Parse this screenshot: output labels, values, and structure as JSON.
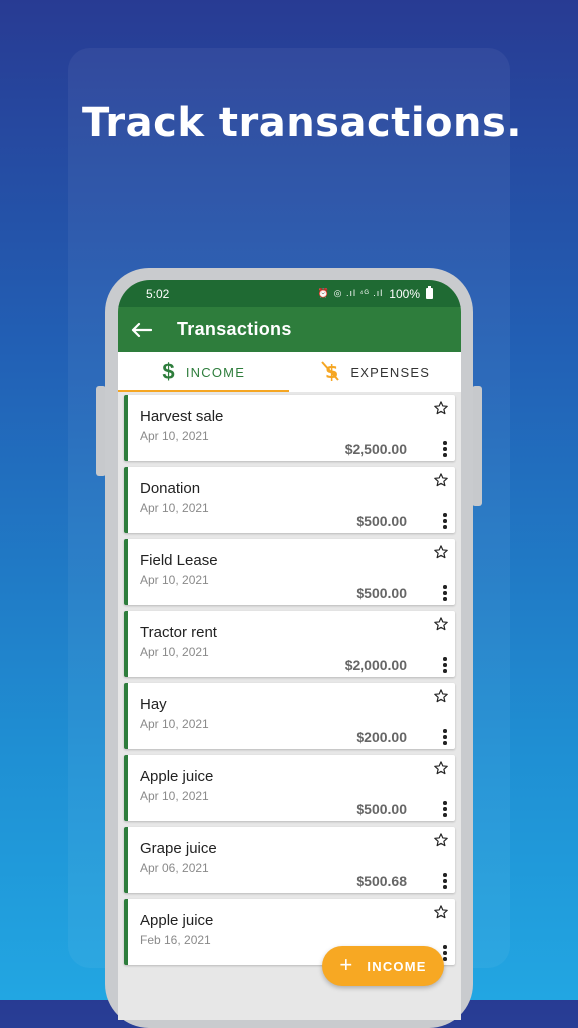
{
  "headline": "Track transactions.",
  "status_bar": {
    "time": "5:02",
    "icons": "⏰ ◎ .ıl ⁴ᴳ .ıl",
    "battery": "100%"
  },
  "app_bar": {
    "back_icon": "arrow-left-icon",
    "title": "Transactions"
  },
  "tabs": [
    {
      "label": "INCOME",
      "icon": "dollar-icon",
      "selected": true
    },
    {
      "label": "EXPENSES",
      "icon": "money-off-icon",
      "selected": false
    }
  ],
  "transactions": [
    {
      "title": "Harvest sale",
      "date": "Apr 10, 2021",
      "amount": "$2,500.00"
    },
    {
      "title": "Donation",
      "date": "Apr 10, 2021",
      "amount": "$500.00"
    },
    {
      "title": "Field Lease",
      "date": "Apr 10, 2021",
      "amount": "$500.00"
    },
    {
      "title": "Tractor rent",
      "date": "Apr 10, 2021",
      "amount": "$2,000.00"
    },
    {
      "title": "Hay",
      "date": "Apr 10, 2021",
      "amount": "$200.00"
    },
    {
      "title": "Apple juice",
      "date": "Apr 10, 2021",
      "amount": "$500.00"
    },
    {
      "title": "Grape juice",
      "date": "Apr 06, 2021",
      "amount": "$500.68"
    },
    {
      "title": "Apple juice",
      "date": "Feb 16, 2021",
      "amount": ""
    }
  ],
  "fab": {
    "icon": "+",
    "label": "INCOME"
  },
  "colors": {
    "primary": "#2e7d3c",
    "primary_dark": "#1f6a33",
    "accent": "#f7a823",
    "background_top": "#283b93",
    "background_bottom": "#22a6e2"
  }
}
